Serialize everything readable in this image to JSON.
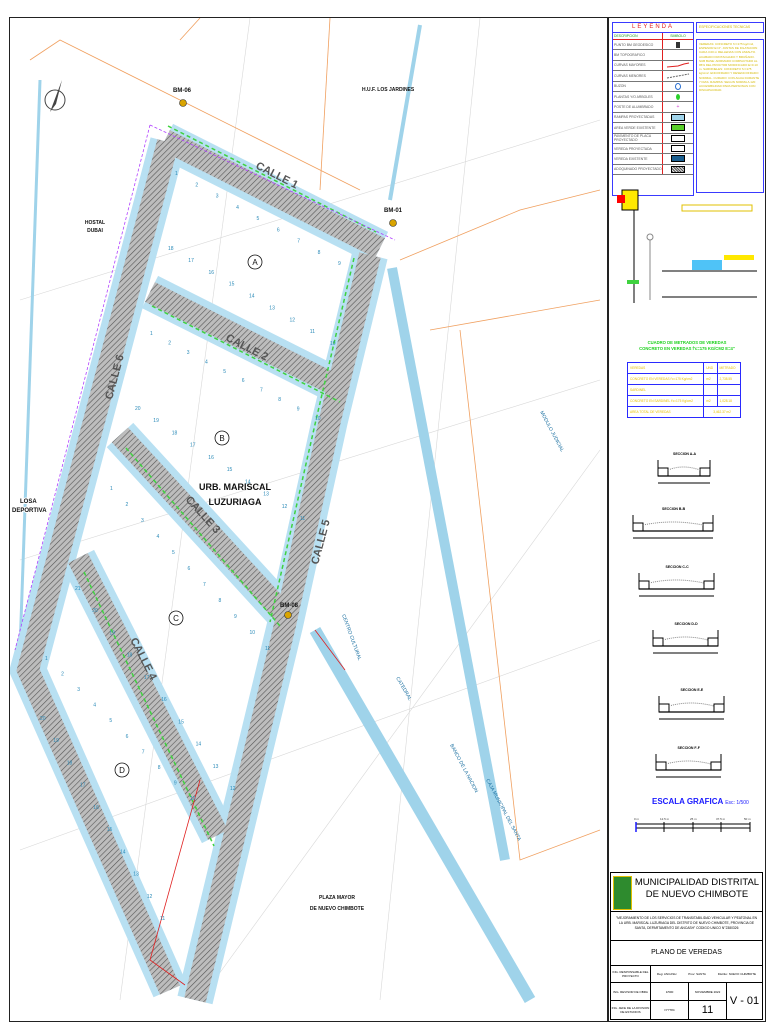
{
  "map": {
    "labels": {
      "bm06": "BM-06",
      "bm01": "BM-01",
      "bm08": "BM-08",
      "huf": "H.U.F. LOS JARDINES",
      "hostal_1": "HOSTAL",
      "hostal_2": "DUBAI",
      "losa_1": "LOSA",
      "losa_2": "DEPORTIVA",
      "urb_1": "URB. MARISCAL",
      "urb_2": "LUZURIAGA",
      "plaza_1": "PLAZA MAYOR",
      "plaza_2": "DE NUEVO CHIMBOTE",
      "centro": "CENTRO CULTURAL",
      "catedral": "CATEDRAL",
      "banco": "BANCO DE LA NACION",
      "caja": "CAJA MUNICIPAL DEL SANTA",
      "modulo": "MODULO JUDICIAL"
    },
    "streets": {
      "calle1": "CALLE 1",
      "calle2": "CALLE 2",
      "calle3": "CALLE 3",
      "calle4": "CALLE 4",
      "calle5": "CALLE 5",
      "calle6": "CALLE 6"
    },
    "blocks": {
      "a": "A",
      "b": "B",
      "c": "C",
      "d": "D"
    },
    "lots": {
      "a": [
        "1",
        "2",
        "3",
        "4",
        "5",
        "6",
        "7",
        "8",
        "9",
        "10",
        "11",
        "12",
        "13",
        "14",
        "15",
        "16",
        "17",
        "18"
      ],
      "b": [
        "1",
        "2",
        "3",
        "4",
        "5",
        "6",
        "7",
        "8",
        "9",
        "10",
        "11",
        "12",
        "13",
        "14",
        "15",
        "16",
        "17",
        "18",
        "19",
        "20"
      ],
      "c": [
        "1",
        "2",
        "3",
        "4",
        "5",
        "6",
        "7",
        "8",
        "9",
        "10",
        "11",
        "12",
        "13",
        "14",
        "15",
        "16",
        "17",
        "18",
        "19",
        "20",
        "21"
      ],
      "d": [
        "1",
        "2",
        "3",
        "4",
        "5",
        "6",
        "7",
        "8",
        "9",
        "10",
        "11",
        "12",
        "13",
        "14",
        "15",
        "16",
        "17",
        "18",
        "19",
        "20"
      ]
    }
  },
  "legend": {
    "title": "LEYENDA",
    "col_desc": "DESCRIPCION",
    "col_sym": "SIMBOLO",
    "items": [
      {
        "label": "PUNTO BM GEODESICO"
      },
      {
        "label": "BM TOPOGRAFICO"
      },
      {
        "label": "CURVAS MAYORES"
      },
      {
        "label": "CURVAS MENORES"
      },
      {
        "label": "BUZON"
      },
      {
        "label": "PLANTAS Y/O ARBOLES"
      },
      {
        "label": "POSTE DE ALUMBRADO"
      },
      {
        "label": "RAMPAS PROYECTADAS"
      },
      {
        "label": "AREA VERDE EXISTENTE"
      },
      {
        "label": "PAVIMENTO DE PLACA PROYECTADO"
      },
      {
        "label": "VEREDA PROYECTADA"
      },
      {
        "label": "VEREDA EXISTENTE"
      },
      {
        "label": "ADOQUINADO PROYECTADO"
      }
    ]
  },
  "notes": {
    "title": "ESPECIFICACIONES TECNICAS",
    "body": "VEREDAS: CONCRETO f'c=175 kg/cm2, ESPESOR E=4\". JUNTAS DE DILATACION CADA 3.00 m RELLENAS CON ASFALTO. ACABADO FROTACHADO Y BRUÑADO. SUB BASE: AFIRMADO COMPACTADO AL 95% DEL PROCTOR MODIFICADO E=0.10 m. SARDINELES: CONCRETO f'c=175 kg/cm2. ENCOFRADO Y DESENCOFRADO NORMAL. CURADO: CON AGUA DURANTE 7 DIAS. RAMPAS: SEGUN NORMA A.120 ACCESIBILIDAD PARA PERSONAS CON DISCAPACIDAD."
  },
  "metrado": {
    "title_1": "CUADRO DE METRADOS DE VEREDAS",
    "title_2": "CONCRETO EN VEREDAS f'c=175 KG/CM2 E=4\"",
    "headers": [
      "VEREDAS",
      "UND",
      "METRADO"
    ],
    "rows": [
      {
        "desc": "CONCRETO EN VEREDAS f'c=175 Kg/cm2",
        "und": "m2",
        "val": "2,738.55"
      },
      {
        "desc": "SARDINEL",
        "und": "",
        "val": ""
      },
      {
        "desc": "CONCRETO EN SARDINEL f'c=175 Kg/cm2",
        "und": "m2",
        "val": "1,028.18"
      }
    ],
    "total_label": "AREA TOTAL DE VEREDAS",
    "total_value": "3,462.37 m2"
  },
  "sections": [
    "SECCION A-A",
    "SECCION B-B",
    "SECCION C-C",
    "SECCION D-D",
    "SECCION E-E",
    "SECCION F-F"
  ],
  "scale": {
    "title": "ESCALA GRAFICA",
    "esc": "Esc: 1/500",
    "ticks": [
      "0 m",
      "12.5 m",
      "25 m",
      "37.5 m",
      "50 m"
    ]
  },
  "title_block": {
    "municipality_1": "MUNICIPALIDAD DISTRITAL",
    "municipality_2": "DE NUEVO CHIMBOTE",
    "project": "\"MEJORAMIENTO DE LOS SERVICIOS DE TRANSITABILIDAD VEHICULAR Y PEATONAL EN LA URB. MARISCAL LUZURIAGA DEL DISTRITO DE NUEVO CHIMBOTE, PROVINCIA DE SANTA, DEPARTAMENTO DE ANCASH\" CODIGO UNICO N°2380326",
    "plan": "PLANO DE VEREDAS",
    "region": "Reg: ANCASH",
    "province": "Prov: SANTA",
    "district": "Distrito: NUEVO CHIMBOTE",
    "designer_1": "ING. RESPONSABLE DEL PROYECTO",
    "designer_2": "ING. REVISOR DE OBRA",
    "designer_3": "ING. JEFE DE LA DIVISION DE ESTUDIOS",
    "scale": "1/500",
    "date": "NOVIEMBRE 2022",
    "code": "N°7784",
    "sheet_no": "11",
    "sheet_code": "V - 01"
  }
}
